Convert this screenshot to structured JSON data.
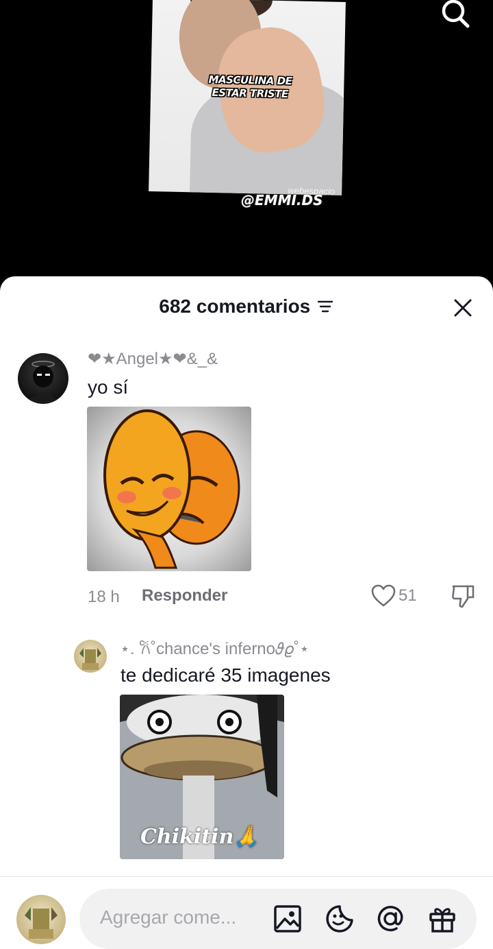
{
  "video": {
    "meme_caption": "MASCULINA DE ESTAR TRISTE",
    "meme_watermark": "webespacio",
    "creator_handle": "@EMMI.DS",
    "search_icon": "search-icon"
  },
  "comments_sheet": {
    "title": "682 comentarios",
    "filter_icon": "filter-icon",
    "close_icon": "close-icon"
  },
  "comments": [
    {
      "username": "❤★Angel★❤&_&",
      "text": "yo sí",
      "image_desc": "emoji-mask-sticker",
      "time": "18 h",
      "reply_label": "Responder",
      "likes": "51"
    },
    {
      "username": "⋆. 𐙚˚chance's inferno𝜗𝜚˚⋆",
      "text": "te dedicaré 35 imagenes",
      "image_caption": "Chikitin🙏"
    }
  ],
  "composer": {
    "placeholder": "Agregar come...",
    "icons": [
      "image-icon",
      "sticker-icon",
      "mention-icon",
      "gift-icon"
    ]
  },
  "colors": {
    "text_primary": "#161823",
    "text_secondary": "#8a8b91",
    "heart_pink": "#f07b8f"
  }
}
